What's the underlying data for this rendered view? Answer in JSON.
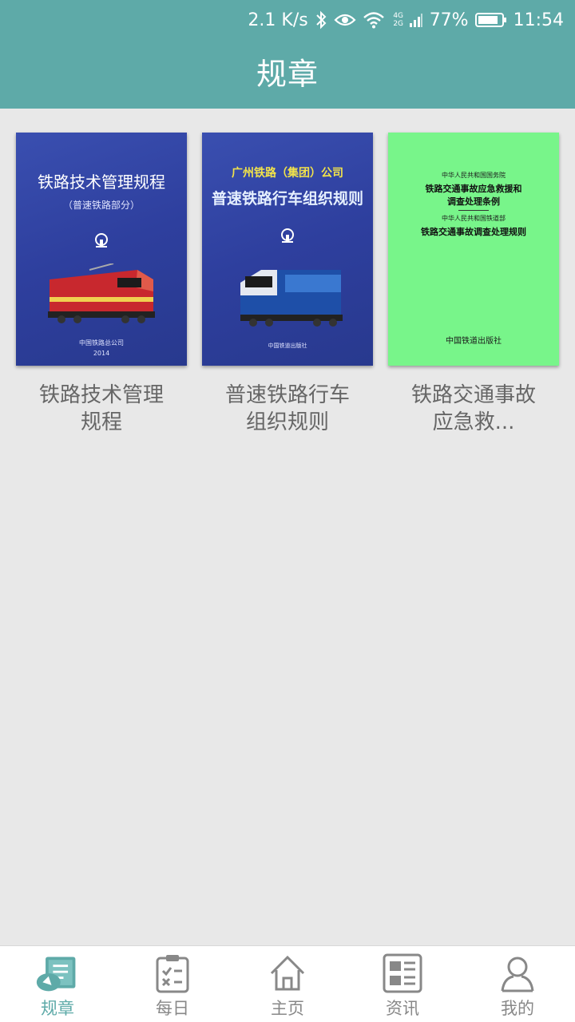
{
  "status_bar": {
    "speed": "2.1 K/s",
    "network": "4G 2G",
    "battery": "77%",
    "time": "11:54"
  },
  "header": {
    "title": "规章"
  },
  "books": [
    {
      "label_line1": "铁路技术管理",
      "label_line2": "规程",
      "cover": {
        "title": "铁路技术管理规程",
        "subtitle": "（普速铁路部分）",
        "publisher": "中国铁路总公司",
        "year": "2014",
        "color": "#3345a6"
      }
    },
    {
      "label_line1": "普速铁路行车",
      "label_line2": "组织规则",
      "cover": {
        "line1": "广州铁路（集团）公司",
        "line2": "普速铁路行车组织规则",
        "publisher": "中国铁道出版社",
        "color": "#3345a6"
      }
    },
    {
      "label_line1": "铁路交通事故",
      "label_line2": "应急救...",
      "cover": {
        "line1": "中华人民共和国国务院",
        "line2": "铁路交通事故应急救援和",
        "line3": "调查处理条例",
        "line4": "中华人民共和国铁道部",
        "line5": "铁路交通事故调查处理规则",
        "publisher": "中国铁道出版社",
        "color": "#78f58a"
      }
    }
  ],
  "bottom_nav": [
    {
      "label": "规章",
      "icon": "book-icon",
      "active": true
    },
    {
      "label": "每日",
      "icon": "checklist-icon",
      "active": false
    },
    {
      "label": "主页",
      "icon": "home-icon",
      "active": false
    },
    {
      "label": "资讯",
      "icon": "news-icon",
      "active": false
    },
    {
      "label": "我的",
      "icon": "user-icon",
      "active": false
    }
  ],
  "colors": {
    "accent": "#5eaaa8",
    "background": "#e8e8e8",
    "inactive": "#888888"
  }
}
